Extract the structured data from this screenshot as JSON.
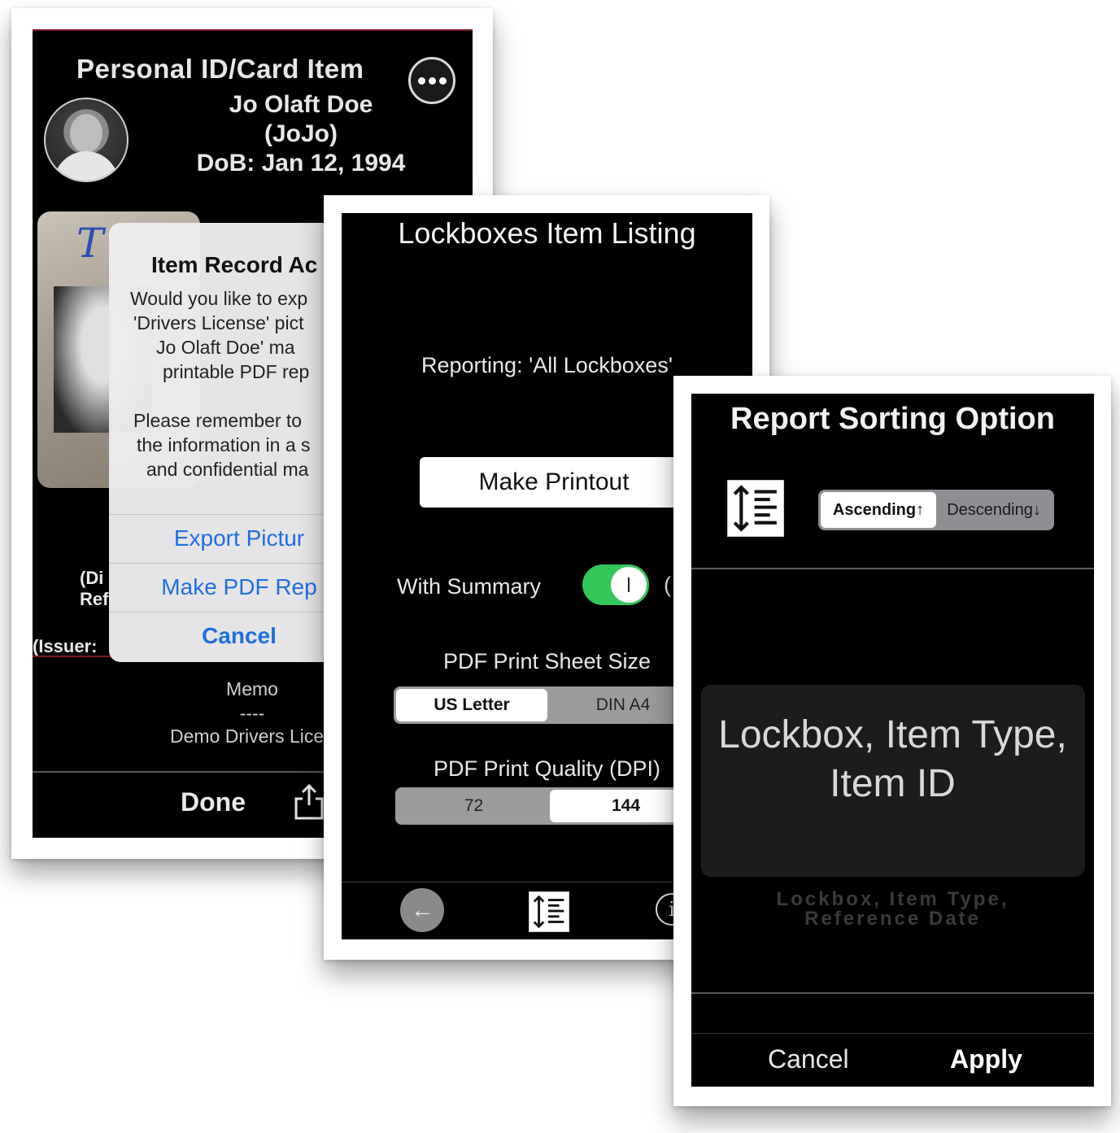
{
  "card1": {
    "title": "Personal ID/Card Item",
    "name": "Jo Olaft Doe",
    "nickname": "(JoJo)",
    "dob": "DoB: Jan 12, 1994",
    "side_left_1": "(Di",
    "side_left_2": "Ref",
    "issuer": "(Issuer: ",
    "alert": {
      "title": "Item Record Ac",
      "line1": "Would you like to exp",
      "line2": "'Drivers License' pict",
      "line3": "Jo  Olaft Doe'    ma",
      "line4": "printable PDF rep",
      "line5": "Please remember to",
      "line6": "the information in a s",
      "line7": "and confidential ma",
      "export_label": "Export Pictur",
      "pdf_label": "Make PDF Rep",
      "cancel_label": "Cancel"
    },
    "memo_label": "Memo",
    "memo_sep": "----",
    "memo_text": "Demo Drivers Licen",
    "done_label": "Done"
  },
  "card2": {
    "title": "Lockboxes Item Listing",
    "reporting": "Reporting: 'All Lockboxes'",
    "print_label": "Make Printout",
    "summary_label": "With Summary",
    "summary_on": true,
    "summary_extra": "(",
    "sheet_label": "PDF Print Sheet Size",
    "sheet_options": [
      "US Letter",
      "DIN A4"
    ],
    "sheet_selected": "US Letter",
    "quality_label": "PDF Print Quality (DPI)",
    "quality_options": [
      "72",
      "144"
    ],
    "quality_selected": "144",
    "info_glyph": "i"
  },
  "card3": {
    "title": "Report Sorting Option",
    "order_options": [
      "Ascending↑",
      "Descending↓"
    ],
    "order_selected": "Ascending↑",
    "picker_selected_line1": "Lockbox, Item Type,",
    "picker_selected_line2": "Item ID",
    "picker_next_line1": "Lockbox, Item Type,",
    "picker_next_line2": "Reference Date",
    "cancel_label": "Cancel",
    "apply_label": "Apply"
  },
  "colors": {
    "screen_bg": "#000000",
    "alert_blue": "#1f6fe0",
    "toggle_green": "#34c759",
    "accent_red": "#7a1b1b"
  }
}
